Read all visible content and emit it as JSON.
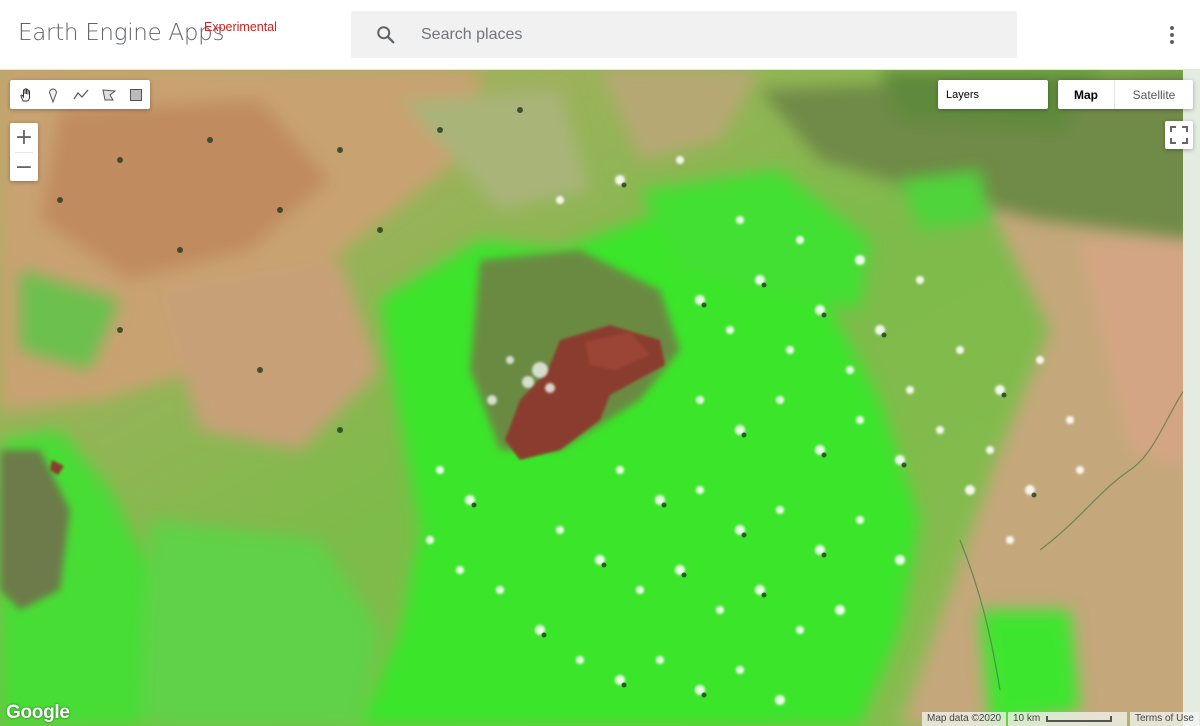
{
  "header": {
    "app_title": "Earth Engine Apps",
    "badge": "Experimental",
    "search_placeholder": "Search places",
    "search_value": ""
  },
  "map": {
    "draw_tools": [
      "hand-icon",
      "marker-icon",
      "polyline-icon",
      "polygon-icon",
      "rectangle-icon"
    ],
    "zoom_in_label": "+",
    "zoom_out_label": "−",
    "layers_label": "Layers",
    "map_type_selected": "Map",
    "map_type_other": "Satellite",
    "google_logo": "Google",
    "attribution": "Map data ©2020",
    "scale_label": "10 km",
    "terms_label": "Terms of Use"
  },
  "colors": {
    "badge": "#c5221f",
    "veg_bright": "#3be52c",
    "dry_tan": "#c9a271",
    "burn_red": "#8a3e2f"
  }
}
